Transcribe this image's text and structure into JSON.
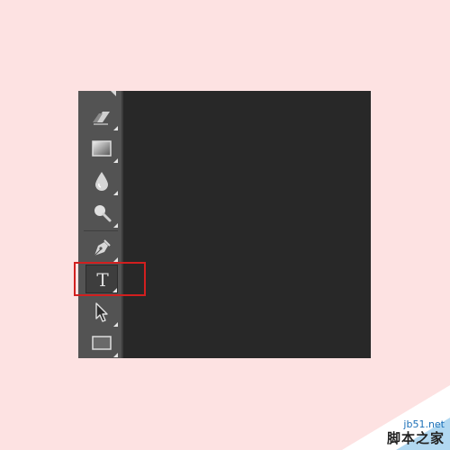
{
  "colors": {
    "page_background": "#fde2e2",
    "toolbar_background": "#535353",
    "canvas_background": "#282828",
    "highlight_border": "#d21f1f"
  },
  "toolbar": {
    "tools": [
      {
        "name": "eraser-tool",
        "icon": "eraser-icon"
      },
      {
        "name": "gradient-tool",
        "icon": "gradient-icon"
      },
      {
        "name": "blur-tool",
        "icon": "blur-drop-icon"
      },
      {
        "name": "dodge-tool",
        "icon": "dodge-icon"
      },
      {
        "name": "pen-tool",
        "icon": "pen-icon"
      },
      {
        "name": "type-tool",
        "icon": "type-icon",
        "label": "T",
        "active": true,
        "highlighted": true
      },
      {
        "name": "path-selection-tool",
        "icon": "arrow-cursor-icon"
      },
      {
        "name": "rectangle-tool",
        "icon": "rectangle-icon"
      }
    ]
  },
  "watermark": {
    "site": "jb51.net",
    "name": "脚本之家"
  }
}
